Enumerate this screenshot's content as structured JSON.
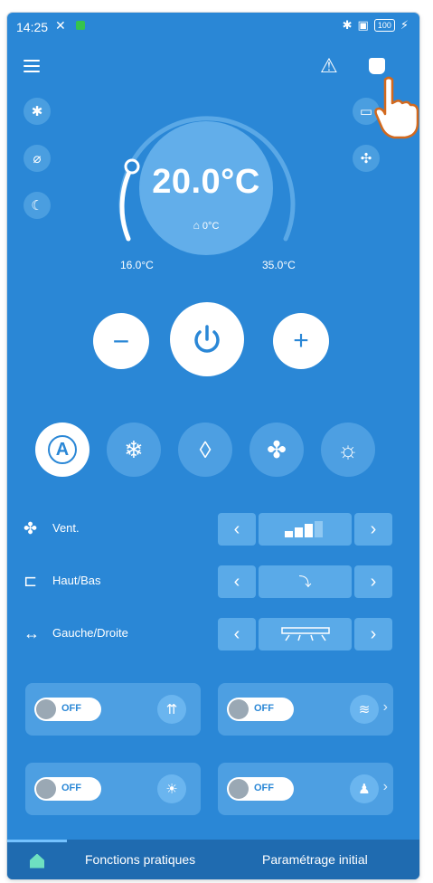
{
  "status_bar": {
    "time": "14:25",
    "battery": "100"
  },
  "dial": {
    "set_temperature": "20.0°C",
    "room_temperature": "0°C",
    "min": "16.0°C",
    "max": "35.0°C"
  },
  "icons": {
    "menu": "menu-icon",
    "warning": "warning-icon",
    "notification": "bell-icon",
    "bluetooth": "bluetooth-icon",
    "eco_off": "eco-off-icon",
    "sleep": "moon-icon",
    "screen": "screen-icon",
    "expand": "expand-icon"
  },
  "modes": [
    {
      "name": "auto",
      "active": true
    },
    {
      "name": "cool",
      "active": false
    },
    {
      "name": "dry",
      "active": false
    },
    {
      "name": "fan",
      "active": false
    },
    {
      "name": "heat",
      "active": false
    }
  ],
  "rows": {
    "fan": {
      "label": "Vent.",
      "level": 3,
      "levels": 4
    },
    "updown": {
      "label": "Haut/Bas"
    },
    "leftright": {
      "label": "Gauche/Droite"
    }
  },
  "cards": [
    {
      "state": "OFF",
      "icon": "airflow-up-icon",
      "chevron": false
    },
    {
      "state": "OFF",
      "icon": "wind-icon",
      "chevron": true
    },
    {
      "state": "OFF",
      "icon": "lightbulb-icon",
      "chevron": false
    },
    {
      "state": "OFF",
      "icon": "person-icon",
      "chevron": true
    }
  ],
  "nav": {
    "tab_functions": "Fonctions pratiques",
    "tab_settings": "Paramétrage initial"
  },
  "colors": {
    "background": "#2a87d6",
    "accent": "#ffffff",
    "button_light": "#5aaae8"
  }
}
